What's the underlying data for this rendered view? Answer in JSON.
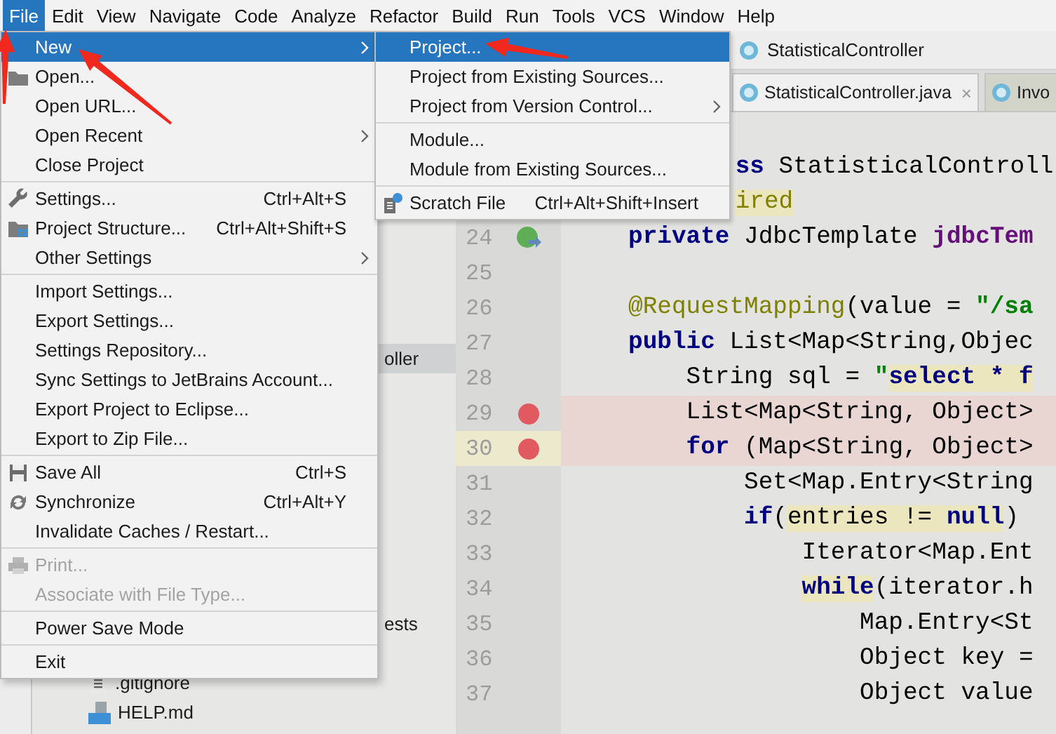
{
  "menubar": [
    {
      "label": "File",
      "selected": true
    },
    {
      "label": "Edit",
      "selected": false
    },
    {
      "label": "View",
      "selected": false
    },
    {
      "label": "Navigate",
      "selected": false
    },
    {
      "label": "Code",
      "selected": false
    },
    {
      "label": "Analyze",
      "selected": false
    },
    {
      "label": "Refactor",
      "selected": false
    },
    {
      "label": "Build",
      "selected": false
    },
    {
      "label": "Run",
      "selected": false
    },
    {
      "label": "Tools",
      "selected": false
    },
    {
      "label": "VCS",
      "selected": false
    },
    {
      "label": "Window",
      "selected": false
    },
    {
      "label": "Help",
      "selected": false
    }
  ],
  "file_menu": {
    "items": [
      {
        "kind": "item",
        "label": "New",
        "submenu": true,
        "selected": true,
        "disabled": false
      },
      {
        "kind": "item",
        "label": "Open...",
        "submenu": false,
        "selected": false,
        "disabled": false
      },
      {
        "kind": "item",
        "label": "Open URL...",
        "submenu": false,
        "selected": false,
        "disabled": false
      },
      {
        "kind": "item",
        "label": "Open Recent",
        "submenu": true,
        "selected": false,
        "disabled": false
      },
      {
        "kind": "item",
        "label": "Close Project",
        "submenu": false,
        "selected": false,
        "disabled": false
      },
      {
        "kind": "separator"
      },
      {
        "kind": "item",
        "label": "Settings...",
        "shortcut": "Ctrl+Alt+S",
        "submenu": false,
        "selected": false,
        "disabled": false
      },
      {
        "kind": "item",
        "label": "Project Structure...",
        "shortcut": "Ctrl+Alt+Shift+S",
        "submenu": false,
        "selected": false,
        "disabled": false
      },
      {
        "kind": "item",
        "label": "Other Settings",
        "submenu": true,
        "selected": false,
        "disabled": false
      },
      {
        "kind": "separator"
      },
      {
        "kind": "item",
        "label": "Import Settings...",
        "submenu": false,
        "selected": false,
        "disabled": false
      },
      {
        "kind": "item",
        "label": "Export Settings...",
        "submenu": false,
        "selected": false,
        "disabled": false
      },
      {
        "kind": "item",
        "label": "Settings Repository...",
        "submenu": false,
        "selected": false,
        "disabled": false
      },
      {
        "kind": "item",
        "label": "Sync Settings to JetBrains Account...",
        "submenu": false,
        "selected": false,
        "disabled": false
      },
      {
        "kind": "item",
        "label": "Export Project to Eclipse...",
        "submenu": false,
        "selected": false,
        "disabled": false
      },
      {
        "kind": "item",
        "label": "Export to Zip File...",
        "submenu": false,
        "selected": false,
        "disabled": false
      },
      {
        "kind": "separator"
      },
      {
        "kind": "item",
        "label": "Save All",
        "shortcut": "Ctrl+S",
        "submenu": false,
        "selected": false,
        "disabled": false
      },
      {
        "kind": "item",
        "label": "Synchronize",
        "shortcut": "Ctrl+Alt+Y",
        "submenu": false,
        "selected": false,
        "disabled": false
      },
      {
        "kind": "item",
        "label": "Invalidate Caches / Restart...",
        "submenu": false,
        "selected": false,
        "disabled": false
      },
      {
        "kind": "separator"
      },
      {
        "kind": "item",
        "label": "Print...",
        "submenu": false,
        "selected": false,
        "disabled": true
      },
      {
        "kind": "item",
        "label": "Associate with File Type...",
        "submenu": false,
        "selected": false,
        "disabled": true
      },
      {
        "kind": "separator"
      },
      {
        "kind": "item",
        "label": "Power Save Mode",
        "submenu": false,
        "selected": false,
        "disabled": false
      },
      {
        "kind": "separator"
      },
      {
        "kind": "item",
        "label": "Exit",
        "submenu": false,
        "selected": false,
        "disabled": false
      }
    ]
  },
  "new_submenu": {
    "items": [
      {
        "kind": "item",
        "label": "Project...",
        "submenu": false,
        "selected": true,
        "disabled": false
      },
      {
        "kind": "item",
        "label": "Project from Existing Sources...",
        "submenu": false,
        "selected": false,
        "disabled": false
      },
      {
        "kind": "item",
        "label": "Project from Version Control...",
        "submenu": true,
        "selected": false,
        "disabled": false
      },
      {
        "kind": "separator"
      },
      {
        "kind": "item",
        "label": "Module...",
        "submenu": false,
        "selected": false,
        "disabled": false
      },
      {
        "kind": "item",
        "label": "Module from Existing Sources...",
        "submenu": false,
        "selected": false,
        "disabled": false
      },
      {
        "kind": "separator"
      },
      {
        "kind": "item",
        "label": "Scratch File",
        "shortcut": "Ctrl+Alt+Shift+Insert",
        "submenu": false,
        "selected": false,
        "disabled": false
      }
    ]
  },
  "project_tree": [
    {
      "kind": "partial",
      "text": "oller",
      "selected": true
    },
    {
      "kind": "partial",
      "text": "ests",
      "selected": false
    },
    {
      "kind": "text_file",
      "text": ".gitignore",
      "selected": false
    },
    {
      "kind": "markdown_file",
      "text": "HELP.md",
      "selected": false
    }
  ],
  "editor": {
    "breadcrumb": "StatisticalController",
    "tabs": [
      {
        "label": "StatisticalController.java",
        "close": "×",
        "selected": true
      },
      {
        "label": "Invo",
        "selected": false
      }
    ],
    "lines": [
      {
        "kind": "partial",
        "breakpoint": false,
        "current": false,
        "marker": false,
        "tokens": [
          {
            "kind": "keyword",
            "text": "ss",
            "highlight": false
          },
          {
            "kind": "plain",
            "text": " StatisticalControll",
            "highlight": false
          }
        ]
      },
      {
        "kind": "partial",
        "breakpoint": false,
        "current": false,
        "marker": false,
        "tokens": [
          {
            "kind": "annotation",
            "text": "ired",
            "highlight": true
          }
        ]
      },
      {
        "kind": "code",
        "number": "24",
        "breakpoint": false,
        "current": false,
        "marker": true,
        "tokens": [
          {
            "kind": "keyword",
            "text": "private",
            "highlight": false
          },
          {
            "kind": "plain",
            "text": " JdbcTemplate ",
            "highlight": false
          },
          {
            "kind": "field",
            "text": "jdbcTem",
            "highlight": false
          }
        ]
      },
      {
        "kind": "code",
        "number": "25",
        "breakpoint": false,
        "current": false,
        "marker": false
      },
      {
        "kind": "code",
        "number": "26",
        "breakpoint": false,
        "current": false,
        "marker": false,
        "tokens": [
          {
            "kind": "annotation",
            "text": "@RequestMapping",
            "highlight": false
          },
          {
            "kind": "plain",
            "text": "(value = ",
            "highlight": false
          },
          {
            "kind": "string",
            "text": "\"/sa",
            "highlight": false
          }
        ]
      },
      {
        "kind": "code",
        "number": "27",
        "breakpoint": false,
        "current": false,
        "marker": false,
        "tokens": [
          {
            "kind": "keyword",
            "text": "public",
            "highlight": false
          },
          {
            "kind": "plain",
            "text": " List<Map<String,Objec",
            "highlight": false
          }
        ]
      },
      {
        "kind": "code",
        "number": "28",
        "breakpoint": false,
        "current": false,
        "marker": false,
        "tokens": [
          {
            "kind": "plain",
            "text": "    String sql = ",
            "highlight": false
          },
          {
            "kind": "string",
            "text": "\"",
            "highlight": false
          },
          {
            "kind": "sql",
            "text": "select * f",
            "highlight": true
          }
        ]
      },
      {
        "kind": "code",
        "number": "29",
        "breakpoint": true,
        "current": false,
        "marker": false,
        "tokens": [
          {
            "kind": "plain",
            "text": "    List<Map<String, Object>",
            "highlight": false
          }
        ]
      },
      {
        "kind": "code",
        "number": "30",
        "breakpoint": true,
        "current": true,
        "marker": false,
        "tokens": [
          {
            "kind": "keyword",
            "text": "    for",
            "highlight": false
          },
          {
            "kind": "plain",
            "text": " (Map<String, Object>",
            "highlight": false
          }
        ]
      },
      {
        "kind": "code",
        "number": "31",
        "breakpoint": false,
        "current": false,
        "marker": false,
        "tokens": [
          {
            "kind": "plain",
            "text": "        Set<Map.Entry<String",
            "highlight": false
          }
        ]
      },
      {
        "kind": "code",
        "number": "32",
        "breakpoint": false,
        "current": false,
        "marker": false,
        "tokens": [
          {
            "kind": "keyword",
            "text": "        if",
            "highlight": false
          },
          {
            "kind": "plain",
            "text": "(",
            "highlight": false
          },
          {
            "kind": "plain",
            "text": "entries != ",
            "highlight": true
          },
          {
            "kind": "keyword",
            "text": "null",
            "highlight": true
          },
          {
            "kind": "plain",
            "text": ")",
            "highlight": false
          }
        ]
      },
      {
        "kind": "code",
        "number": "33",
        "breakpoint": false,
        "current": false,
        "marker": false,
        "tokens": [
          {
            "kind": "plain",
            "text": "            Iterator<Map.Ent",
            "highlight": false
          }
        ]
      },
      {
        "kind": "code",
        "number": "34",
        "breakpoint": false,
        "current": false,
        "marker": false,
        "tokens": [
          {
            "kind": "keyword",
            "text": "            while",
            "highlight": true
          },
          {
            "kind": "plain",
            "text": "(iterator.h",
            "highlight": false
          }
        ]
      },
      {
        "kind": "code",
        "number": "35",
        "breakpoint": false,
        "current": false,
        "marker": false,
        "tokens": [
          {
            "kind": "plain",
            "text": "                Map.Entry<St",
            "highlight": false
          }
        ]
      },
      {
        "kind": "code",
        "number": "36",
        "breakpoint": false,
        "current": false,
        "marker": false,
        "tokens": [
          {
            "kind": "plain",
            "text": "                Object key =",
            "highlight": false
          }
        ]
      },
      {
        "kind": "code",
        "number": "37",
        "breakpoint": false,
        "current": false,
        "marker": false,
        "tokens": [
          {
            "kind": "plain",
            "text": "                Object value",
            "highlight": false
          }
        ]
      }
    ]
  }
}
